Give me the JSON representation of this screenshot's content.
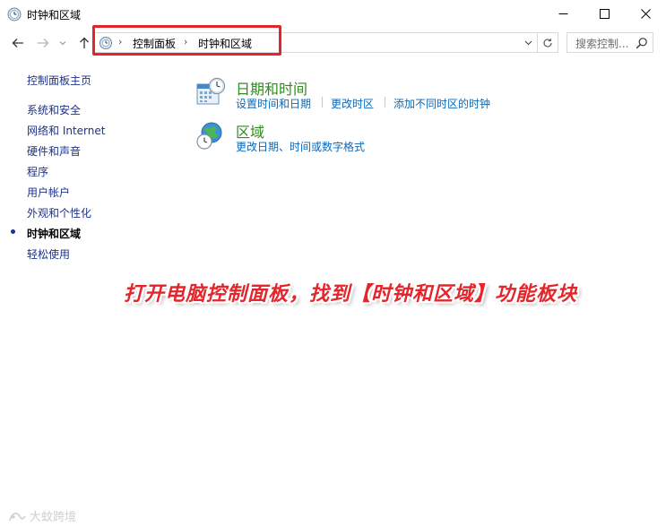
{
  "window": {
    "title": "时钟和区域"
  },
  "address": {
    "crumbs": [
      "控制面板",
      "时钟和区域"
    ],
    "search_placeholder": "搜索控制..."
  },
  "leftnav": {
    "items": [
      {
        "label": "控制面板主页"
      },
      {
        "label": "系统和安全"
      },
      {
        "label": "网络和 Internet"
      },
      {
        "label": "硬件和声音"
      },
      {
        "label": "程序"
      },
      {
        "label": "用户帐户"
      },
      {
        "label": "外观和个性化"
      },
      {
        "label": "时钟和区域",
        "active": true
      },
      {
        "label": "轻松使用"
      }
    ]
  },
  "categories": [
    {
      "title": "日期和时间",
      "links": [
        "设置时间和日期",
        "更改时区",
        "添加不同时区的时钟"
      ]
    },
    {
      "title": "区域",
      "links": [
        "更改日期、时间或数字格式"
      ]
    }
  ],
  "caption": "打开电脑控制面板，找到【时钟和区域】功能板块",
  "watermark": "大蚊跨境",
  "colors": {
    "highlight": "#e0262b",
    "link": "#0d67b8",
    "category_title": "#2d8c1e",
    "nav_link": "#1e3287"
  }
}
